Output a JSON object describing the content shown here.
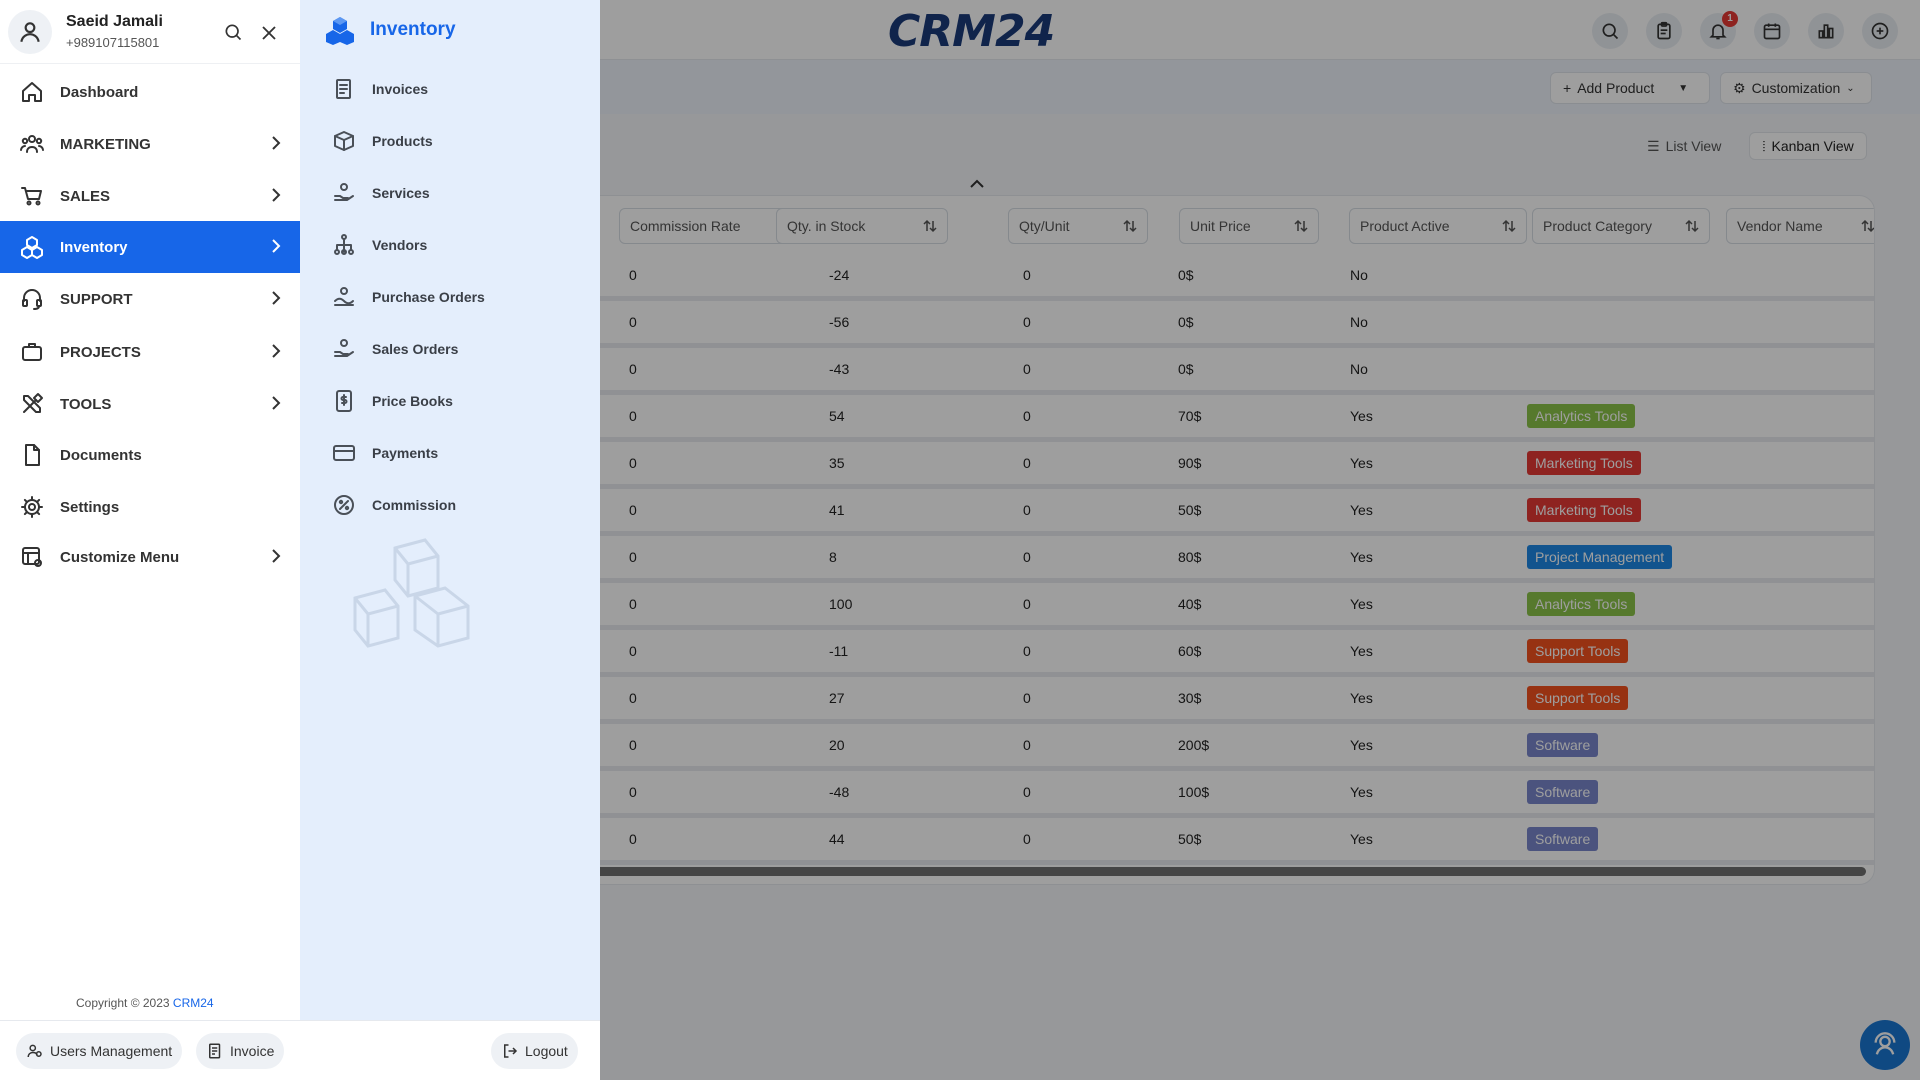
{
  "app": {
    "logo_text": "CRM24",
    "notification_count": "1"
  },
  "toolbar": {
    "add_product_label": "Add Product",
    "customization_label": "Customization"
  },
  "views": {
    "list_label": "List View",
    "kanban_label": "Kanban View"
  },
  "table": {
    "columns": [
      "Commission Rate",
      "Qty. in Stock",
      "Qty/Unit",
      "Unit Price",
      "Product Active",
      "Product Category",
      "Vendor Name"
    ],
    "rows": [
      {
        "commission": "0",
        "qty_stock": "-24",
        "qty_unit": "0",
        "price": "0$",
        "active": "No",
        "category": ""
      },
      {
        "commission": "0",
        "qty_stock": "-56",
        "qty_unit": "0",
        "price": "0$",
        "active": "No",
        "category": ""
      },
      {
        "commission": "0",
        "qty_stock": "-43",
        "qty_unit": "0",
        "price": "0$",
        "active": "No",
        "category": ""
      },
      {
        "commission": "0",
        "qty_stock": "54",
        "qty_unit": "0",
        "price": "70$",
        "active": "Yes",
        "category": "Analytics Tools"
      },
      {
        "commission": "0",
        "qty_stock": "35",
        "qty_unit": "0",
        "price": "90$",
        "active": "Yes",
        "category": "Marketing Tools"
      },
      {
        "commission": "0",
        "qty_stock": "41",
        "qty_unit": "0",
        "price": "50$",
        "active": "Yes",
        "category": "Marketing Tools"
      },
      {
        "commission": "0",
        "qty_stock": "8",
        "qty_unit": "0",
        "price": "80$",
        "active": "Yes",
        "category": "Project Management"
      },
      {
        "commission": "0",
        "qty_stock": "100",
        "qty_unit": "0",
        "price": "40$",
        "active": "Yes",
        "category": "Analytics Tools"
      },
      {
        "commission": "0",
        "qty_stock": "-11",
        "qty_unit": "0",
        "price": "60$",
        "active": "Yes",
        "category": "Support Tools"
      },
      {
        "commission": "0",
        "qty_stock": "27",
        "qty_unit": "0",
        "price": "30$",
        "active": "Yes",
        "category": "Support Tools"
      },
      {
        "commission": "0",
        "qty_stock": "20",
        "qty_unit": "0",
        "price": "200$",
        "active": "Yes",
        "category": "Software"
      },
      {
        "commission": "0",
        "qty_stock": "-48",
        "qty_unit": "0",
        "price": "100$",
        "active": "Yes",
        "category": "Software"
      },
      {
        "commission": "0",
        "qty_stock": "44",
        "qty_unit": "0",
        "price": "50$",
        "active": "Yes",
        "category": "Software"
      }
    ],
    "category_colors": {
      "Analytics Tools": "#8bc34a",
      "Marketing Tools": "#e53935",
      "Project Management": "#1e88e5",
      "Support Tools": "#f4511e",
      "Software": "#7986cb"
    }
  },
  "profile": {
    "name": "Saeid Jamali",
    "phone": "+989107115801"
  },
  "sidebar": {
    "items": [
      {
        "label": "Dashboard",
        "icon": "home-icon",
        "has_children": false
      },
      {
        "label": "MARKETING",
        "icon": "users-group-icon",
        "has_children": true
      },
      {
        "label": "SALES",
        "icon": "cart-icon",
        "has_children": true
      },
      {
        "label": "Inventory",
        "icon": "boxes-icon",
        "has_children": true,
        "active": true
      },
      {
        "label": "SUPPORT",
        "icon": "headset-icon",
        "has_children": true
      },
      {
        "label": "PROJECTS",
        "icon": "briefcase-icon",
        "has_children": true
      },
      {
        "label": "TOOLS",
        "icon": "tools-icon",
        "has_children": true
      },
      {
        "label": "Documents",
        "icon": "document-icon",
        "has_children": false
      },
      {
        "label": "Settings",
        "icon": "gear-icon",
        "has_children": false
      },
      {
        "label": "Customize Menu",
        "icon": "customize-icon",
        "has_children": true
      }
    ],
    "copyright_prefix": "Copyright © 2023 ",
    "copyright_brand": "CRM24",
    "accent_color": "#1766e8"
  },
  "submenu": {
    "title": "Inventory",
    "items": [
      {
        "label": "Invoices",
        "icon": "invoice-icon"
      },
      {
        "label": "Products",
        "icon": "product-box-icon"
      },
      {
        "label": "Services",
        "icon": "service-hand-icon"
      },
      {
        "label": "Vendors",
        "icon": "vendor-tree-icon"
      },
      {
        "label": "Purchase Orders",
        "icon": "purchase-order-icon"
      },
      {
        "label": "Sales Orders",
        "icon": "sales-order-icon"
      },
      {
        "label": "Price Books",
        "icon": "price-book-icon"
      },
      {
        "label": "Payments",
        "icon": "payment-card-icon"
      },
      {
        "label": "Commission",
        "icon": "percent-icon"
      }
    ],
    "background": "#e4eefc"
  },
  "footer": {
    "users_management_label": "Users Management",
    "invoice_label": "Invoice",
    "logout_label": "Logout"
  }
}
